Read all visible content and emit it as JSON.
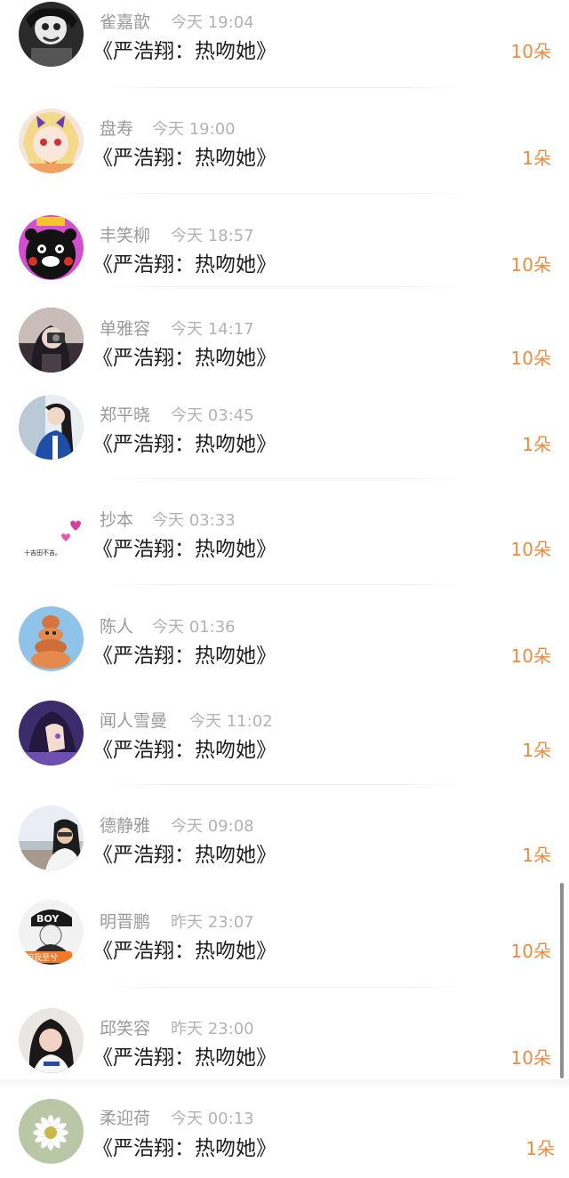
{
  "book_prefix": "《严浩翔：热吻她》",
  "accent_color": "#f08a3c",
  "rows": [
    {
      "name": "雀嘉歆",
      "time": "今天 19:04",
      "book": "《严浩翔：热吻她》",
      "count": "10朵",
      "avatar": "dark-portrait"
    },
    {
      "name": "盘寿",
      "time": "今天 19:00",
      "book": "《严浩翔：热吻她》",
      "count": "1朵",
      "avatar": "anime-blonde"
    },
    {
      "name": "丰笑柳",
      "time": "今天 18:57",
      "book": "《严浩翔：热吻她》",
      "count": "10朵",
      "avatar": "kumamon"
    },
    {
      "name": "单雅容",
      "time": "今天 14:17",
      "book": "《严浩翔：热吻她》",
      "count": "10朵",
      "avatar": "camera-girl"
    },
    {
      "name": "郑平晓",
      "time": "今天 03:45",
      "book": "《严浩翔：热吻她》",
      "count": "1朵",
      "avatar": "blue-jacket-girl"
    },
    {
      "name": "抄本",
      "time": "今天 03:33",
      "book": "《严浩翔：热吻她》",
      "count": "10朵",
      "avatar": "hearts-text"
    },
    {
      "name": "陈人",
      "time": "今天 01:36",
      "book": "《严浩翔：热吻她》",
      "count": "10朵",
      "avatar": "cartoon-figure"
    },
    {
      "name": "闻人雪曼",
      "time": "今天 11:02",
      "book": "《严浩翔：热吻她》",
      "count": "1朵",
      "avatar": "anime-purple"
    },
    {
      "name": "德静雅",
      "time": "今天 09:08",
      "book": "《严浩翔：热吻她》",
      "count": "1朵",
      "avatar": "beach-portrait"
    },
    {
      "name": "明晋鹏",
      "time": "昨天 23:07",
      "book": "《严浩翔：热吻她》",
      "count": "10朵",
      "avatar": "boy-cap"
    },
    {
      "name": "邱笑容",
      "time": "昨天 23:00",
      "book": "《严浩翔：热吻她》",
      "count": "10朵",
      "avatar": "girl-longhair"
    },
    {
      "name": "柔迎荷",
      "time": "今天 00:13",
      "book": "《严浩翔：热吻她》",
      "count": "1朵",
      "avatar": "daisy-flower"
    }
  ],
  "avatar_texts": {
    "hearts_caption": "十吉田不吉。",
    "boy_cap_text": "BOY",
    "boy_badge": "问我至兮"
  }
}
